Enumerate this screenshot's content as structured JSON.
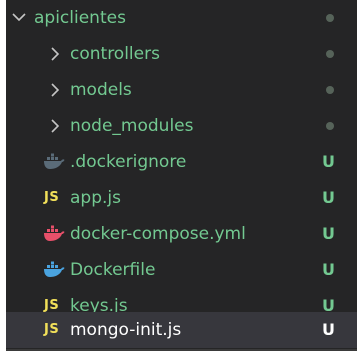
{
  "explorer": {
    "root": {
      "label": "apiclientes"
    },
    "items": [
      {
        "label": "controllers",
        "kind": "folder",
        "icon": "chevron-right-icon"
      },
      {
        "label": "models",
        "kind": "folder",
        "icon": "chevron-right-icon"
      },
      {
        "label": "node_modules",
        "kind": "folder",
        "icon": "chevron-right-icon"
      },
      {
        "label": ".dockerignore",
        "kind": "file",
        "icon": "docker-icon",
        "status": "U"
      },
      {
        "label": "app.js",
        "kind": "file",
        "icon": "javascript-icon",
        "icon_text": "JS",
        "status": "U"
      },
      {
        "label": "docker-compose.yml",
        "kind": "file",
        "icon": "docker-compose-icon",
        "status": "U"
      },
      {
        "label": "Dockerfile",
        "kind": "file",
        "icon": "docker-icon",
        "status": "U"
      },
      {
        "label": "keys.js",
        "kind": "file",
        "icon": "javascript-icon",
        "icon_text": "JS",
        "status": "U"
      },
      {
        "label": "mongo-init.js",
        "kind": "file",
        "icon": "javascript-icon",
        "icon_text": "JS",
        "status": "U",
        "selected": true
      }
    ]
  },
  "colors": {
    "background": "#252526",
    "untracked_text": "#73c991",
    "selected_row": "#37373d",
    "js_icon": "#f1e05a",
    "docker_icon": "#4aa3df",
    "compose_icon": "#e8506a"
  }
}
